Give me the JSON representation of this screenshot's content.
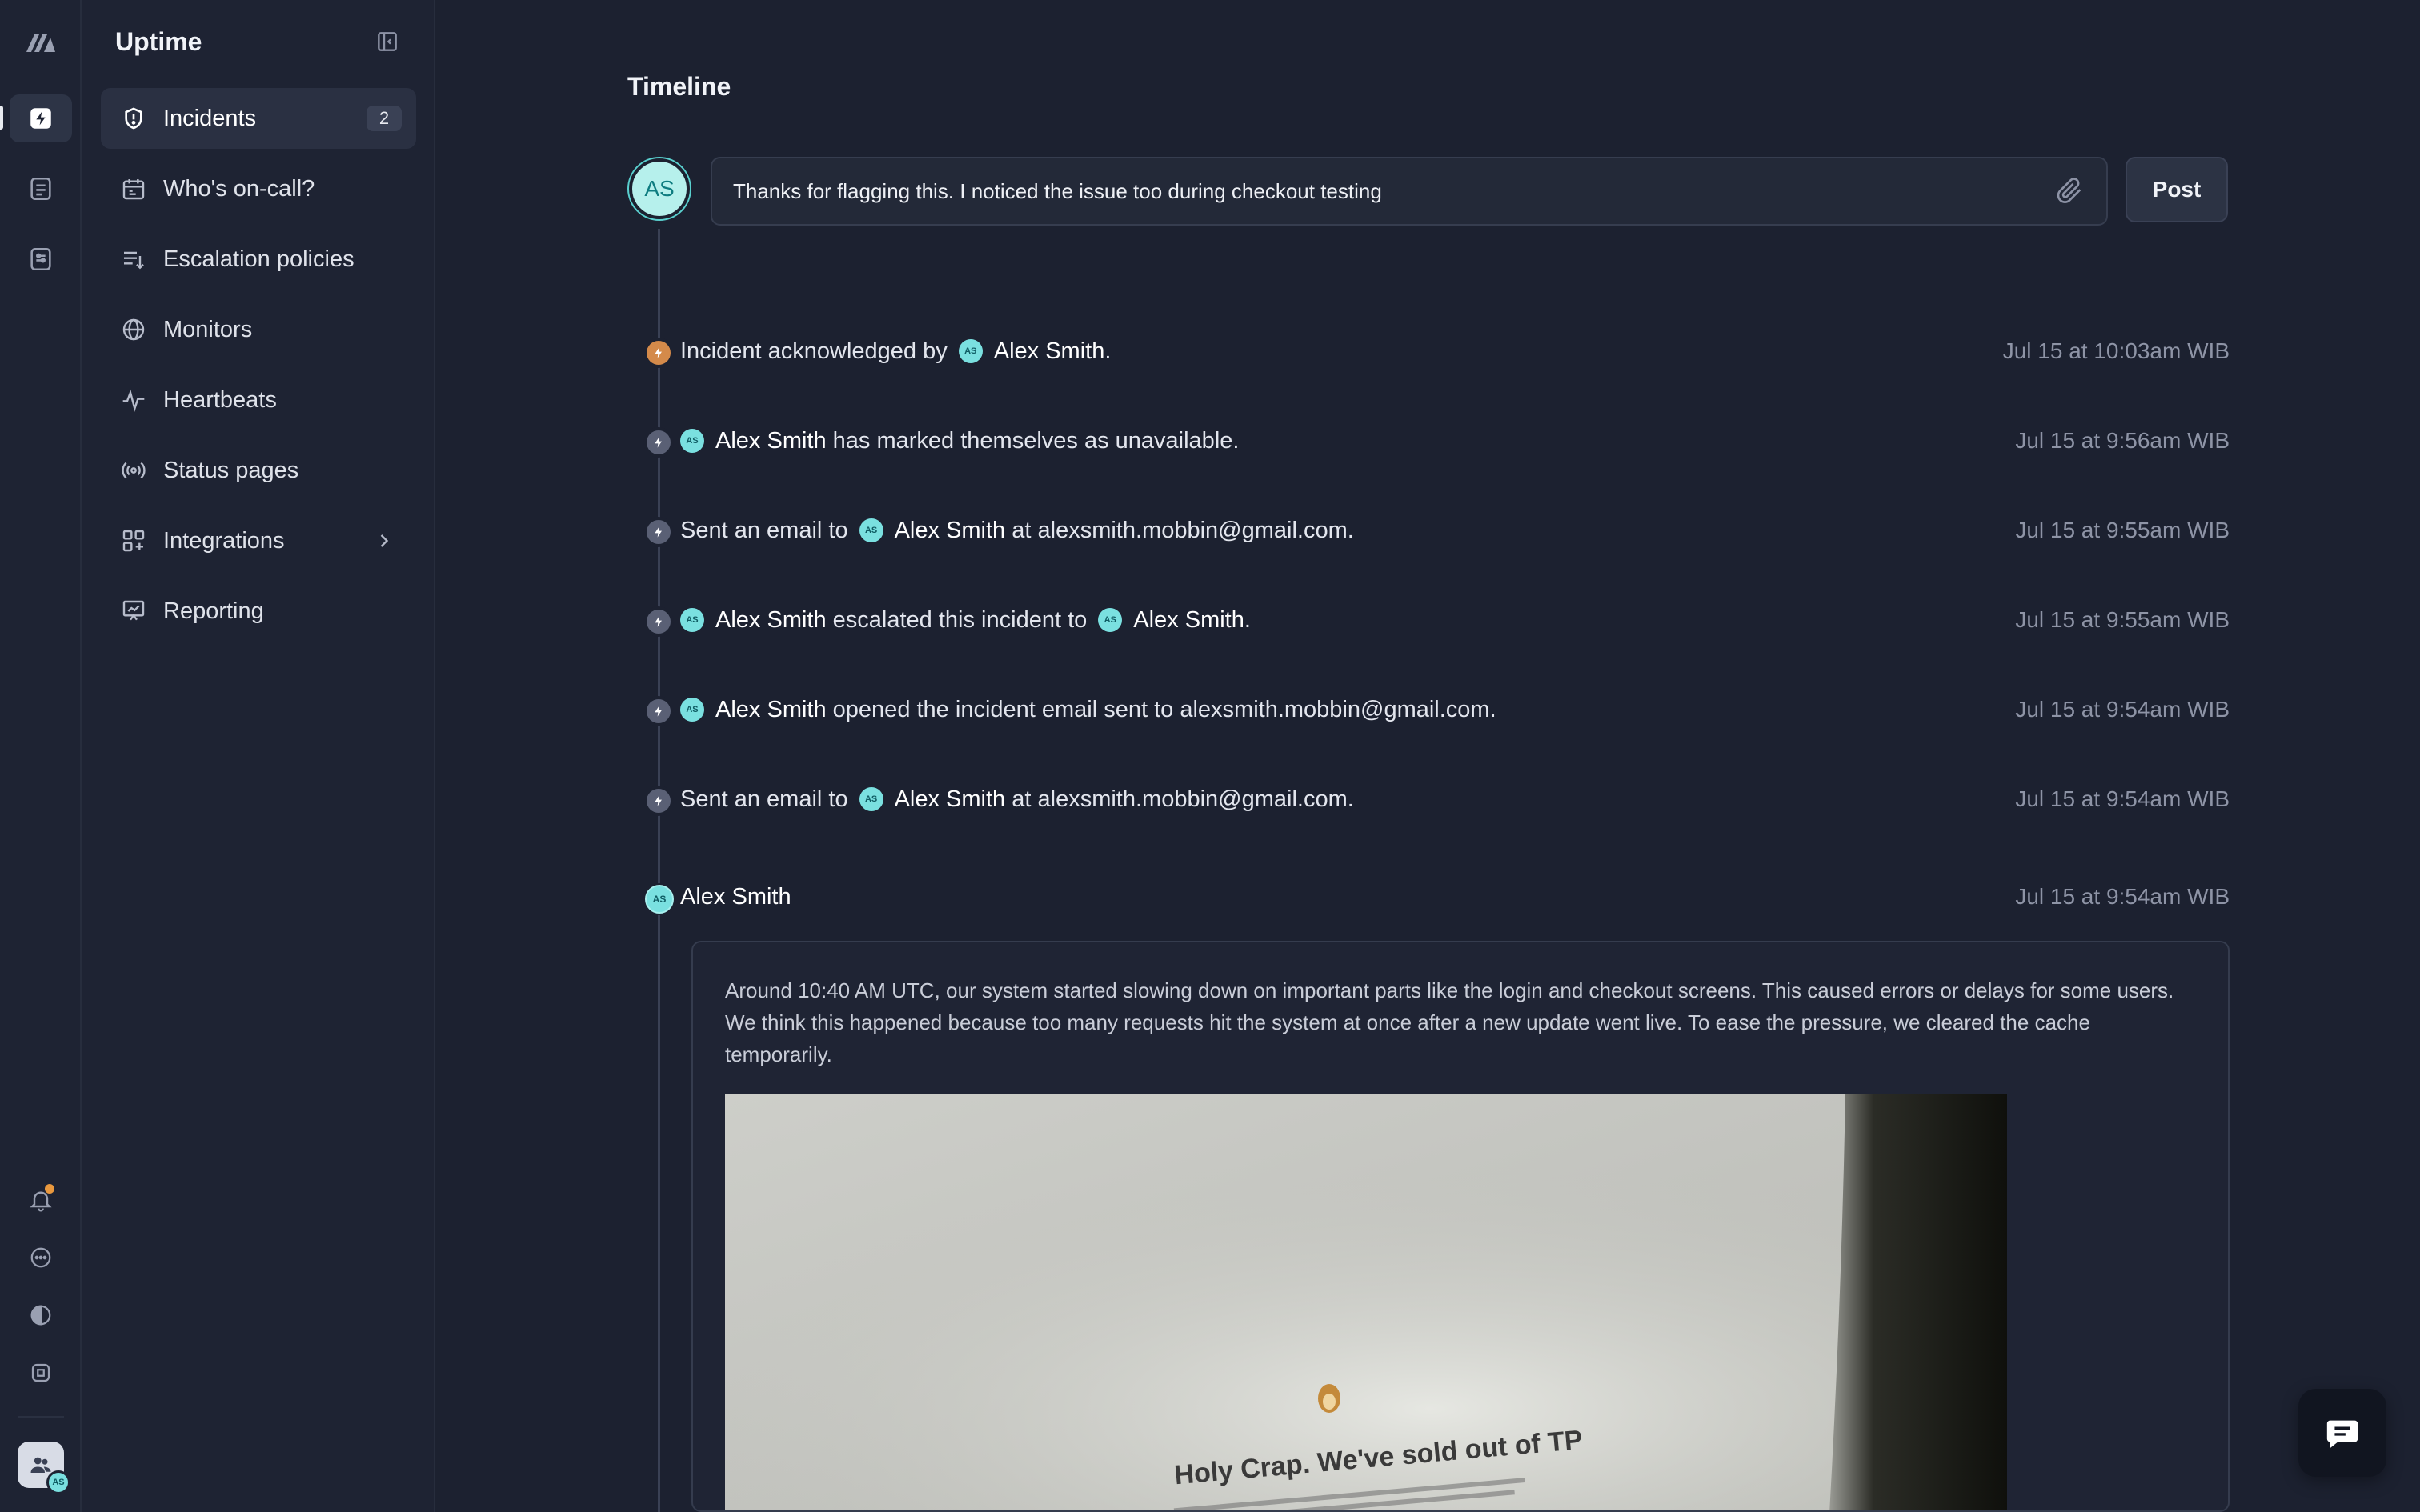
{
  "app": {
    "title": "Uptime"
  },
  "sidebar": {
    "items": [
      {
        "label": "Incidents",
        "badge": "2",
        "icon": "shield-alert-icon"
      },
      {
        "label": "Who's on-call?",
        "icon": "calendar-icon"
      },
      {
        "label": "Escalation policies",
        "icon": "list-down-icon"
      },
      {
        "label": "Monitors",
        "icon": "globe-icon"
      },
      {
        "label": "Heartbeats",
        "icon": "pulse-icon"
      },
      {
        "label": "Status pages",
        "icon": "broadcast-icon"
      },
      {
        "label": "Integrations",
        "icon": "grid-plus-icon"
      },
      {
        "label": "Reporting",
        "icon": "presentation-chart-icon"
      }
    ]
  },
  "timeline": {
    "title": "Timeline",
    "composer": {
      "avatar_initials": "AS",
      "value": "Thanks for flagging this. I noticed the issue too during checkout testing",
      "post_label": "Post"
    },
    "events": [
      {
        "pre": "Incident acknowledged by",
        "name": "Alex Smith",
        "post": ".",
        "time": "Jul 15 at 10:03am WIB",
        "dot": "orange"
      },
      {
        "pre": "",
        "name": "Alex Smith",
        "post": "has marked themselves as unavailable.",
        "time": "Jul 15 at 9:56am WIB",
        "dot": "gray"
      },
      {
        "pre": "Sent an email to",
        "name": "Alex Smith",
        "post": "at alexsmith.mobbin@gmail.com.",
        "time": "Jul 15 at 9:55am WIB",
        "dot": "gray"
      },
      {
        "pre": "",
        "name": "Alex Smith",
        "post": "escalated this incident to",
        "name2": "Alex Smith",
        "post2": ".",
        "time": "Jul 15 at 9:55am WIB",
        "dot": "gray"
      },
      {
        "pre": "",
        "name": "Alex Smith",
        "post": "opened the incident email sent to alexsmith.mobbin@gmail.com.",
        "time": "Jul 15 at 9:54am WIB",
        "dot": "gray"
      },
      {
        "pre": "Sent an email to",
        "name": "Alex Smith",
        "post": "at alexsmith.mobbin@gmail.com.",
        "time": "Jul 15 at 9:54am WIB",
        "dot": "gray"
      }
    ],
    "comment": {
      "author": "Alex Smith",
      "time": "Jul 15 at 9:54am WIB",
      "text": "Around 10:40 AM UTC, our system started slowing down on important parts like the login and checkout screens. This caused errors or delays for some users. We think this happened because too many requests hit the system at once after a new update went live. To ease the pressure, we cleared the cache temporarily.",
      "image_caption": "Holy Crap. We've sold out of TP"
    }
  },
  "avatar_initials_small": "AS"
}
